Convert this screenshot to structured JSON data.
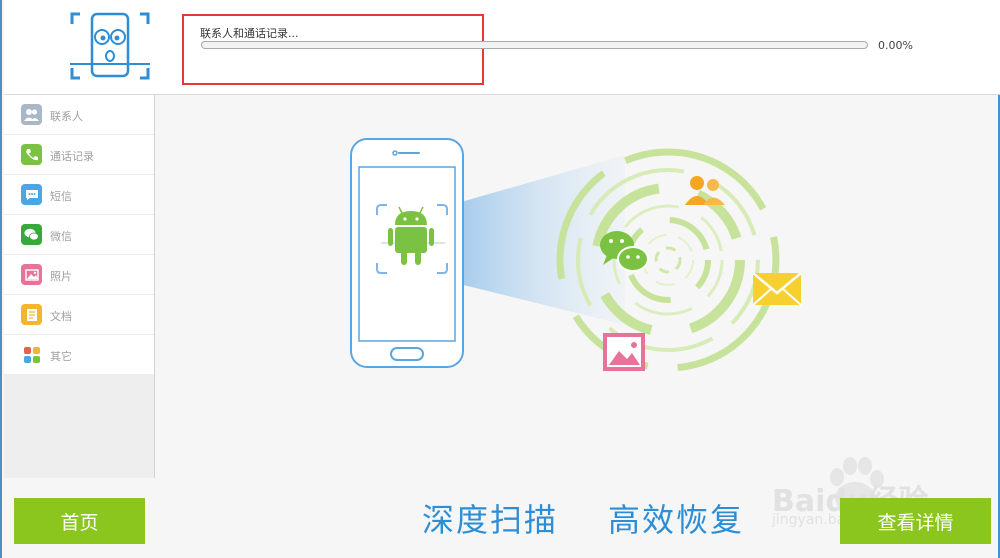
{
  "header": {
    "progress_label": "联系人和通话记录...",
    "progress_percent": "0.00%",
    "progress_value": 0
  },
  "sidebar": {
    "items": [
      {
        "label": "联系人",
        "icon": "contacts-icon",
        "color": "#a9b7c6"
      },
      {
        "label": "通话记录",
        "icon": "phone-icon",
        "color": "#7cc242"
      },
      {
        "label": "短信",
        "icon": "sms-icon",
        "color": "#4aa7e0"
      },
      {
        "label": "微信",
        "icon": "wechat-icon",
        "color": "#37a93b"
      },
      {
        "label": "照片",
        "icon": "photo-icon",
        "color": "#e7739b"
      },
      {
        "label": "文档",
        "icon": "document-icon",
        "color": "#f5b431"
      },
      {
        "label": "其它",
        "icon": "other-icon",
        "color": "#e8604c"
      }
    ]
  },
  "main": {
    "slogan_left": "深度扫描",
    "slogan_right": "高效恢复"
  },
  "footer": {
    "home_label": "首页",
    "detail_label": "查看详情"
  },
  "watermark": {
    "text": "Baidu经验",
    "sub": "jingyan.baidu.com"
  },
  "colors": {
    "accent_green": "#8bc61e",
    "accent_blue": "#2d8ed6",
    "highlight_red": "#e53935"
  }
}
